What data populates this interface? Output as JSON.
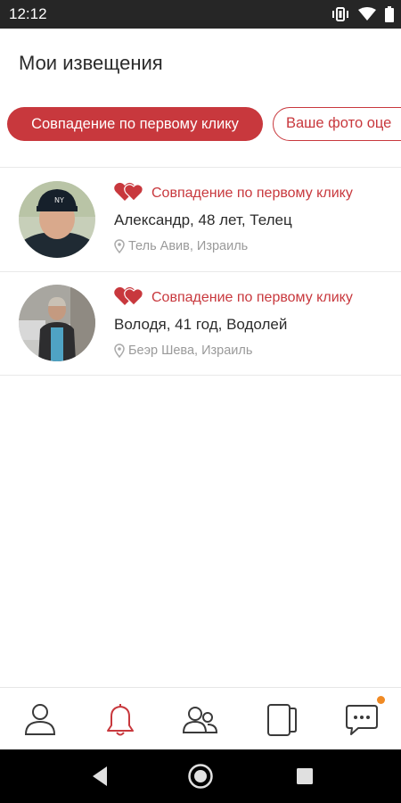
{
  "status_bar": {
    "time": "12:12",
    "icons": [
      "vibrate-icon",
      "wifi-icon",
      "battery-icon"
    ]
  },
  "page": {
    "title": "Мои извещения"
  },
  "filters": [
    {
      "label": "Совпадение по первому клику",
      "active": true
    },
    {
      "label": "Ваше фото оце",
      "active": false
    }
  ],
  "notifications": [
    {
      "type_label": "Совпадение по первому клику",
      "person": "Александр, 48 лет, Телец",
      "location": "Тель Авив, Израиль",
      "icon": "double-heart-icon"
    },
    {
      "type_label": "Совпадение по первому клику",
      "person": "Володя, 41 год, Водолей",
      "location": "Беэр Шева, Израиль",
      "icon": "double-heart-icon"
    }
  ],
  "bottom_nav": {
    "items": [
      "profile-icon",
      "bell-icon",
      "people-icon",
      "cards-icon",
      "chat-icon"
    ],
    "active": "bell-icon",
    "unread_dot_on": "chat-icon"
  },
  "colors": {
    "accent": "#c8383d",
    "status_bar": "#262626",
    "badge": "#f08a24"
  }
}
